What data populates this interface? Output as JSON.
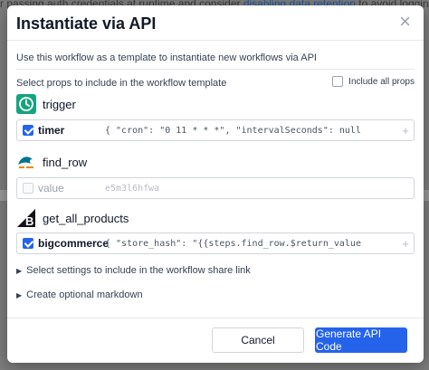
{
  "backdrop": {
    "text_before": "r passing auth credentials at runtime and consider ",
    "link": "disabling data retention",
    "text_after": " to avoid logging sensitive"
  },
  "modal": {
    "title": "Instantiate via API",
    "close_label": "×",
    "intro": "Use this workflow as a template to instantiate new workflows via API",
    "select_label": "Select props to include in the workflow template",
    "include_all_label": "Include all props",
    "steps": [
      {
        "name": "trigger",
        "icon": "clock-icon",
        "prop": {
          "name": "timer",
          "value": "{ \"cron\": \"0 11 * * *\", \"intervalSeconds\": null",
          "checked": true,
          "disabled": false
        }
      },
      {
        "name": "find_row",
        "icon": "mysql-icon",
        "prop": {
          "name": "value",
          "value": "e5m3l6hfwa",
          "checked": false,
          "disabled": true
        }
      },
      {
        "name": "get_all_products",
        "icon": "bigcommerce-icon",
        "prop": {
          "name": "bigcommerce",
          "value": "{ \"store_hash\": \"{{steps.find_row.$return_value",
          "checked": true,
          "disabled": false
        }
      }
    ],
    "plus_label": "+",
    "share_settings_label": "Select settings to include in the workflow share link",
    "markdown_label": "Create optional markdown",
    "cancel_label": "Cancel",
    "generate_label": "Generate API Code"
  },
  "colors": {
    "accent": "#2563eb",
    "trigger_icon": "#16a37f",
    "mysql_icon": "#00758f",
    "bigcommerce_icon": "#121118"
  }
}
